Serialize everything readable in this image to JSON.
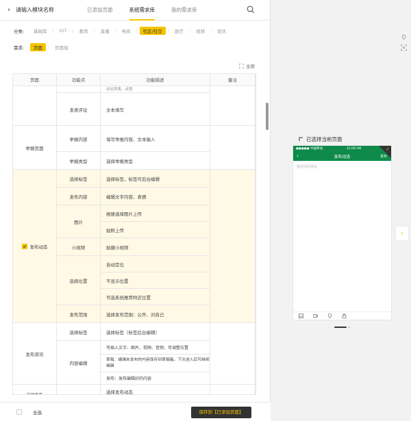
{
  "header": {
    "back": "‹",
    "module_name": "请输入模块名称",
    "tabs": [
      {
        "label": "已添加页面"
      },
      {
        "label": "系统需求库"
      },
      {
        "label": "我的需求库"
      }
    ]
  },
  "category": {
    "label": "分类:",
    "items": [
      "基础库",
      "IOT",
      "教育",
      "直播",
      "电商",
      "社区/社交",
      "医疗",
      "视频",
      "资讯"
    ],
    "selected": "社区/社交"
  },
  "demand": {
    "label": "需求:",
    "items": [
      "页面",
      "页面组"
    ],
    "selected": "页面"
  },
  "fullscreen_label": "全屏",
  "table": {
    "headers": [
      "页面",
      "功能点",
      "功能描述",
      "备注"
    ],
    "partial_top": "评论列表、点赞",
    "rows": {
      "comment_fn": "发表评论",
      "comment_desc": "文本填写",
      "report_page": "举报页面",
      "report_content_fn": "举报内容",
      "report_content_desc": "填写举报内容、文本输入",
      "report_type_fn": "举报类型",
      "report_type_desc": "选择举报类型",
      "post_page": "发布动态",
      "tag_fn": "选择标签",
      "tag_desc": "选择标签，标签可后台编辑",
      "content_fn": "发布内容",
      "content_desc": "编辑文字内容、表情",
      "image_fn": "图片",
      "image_desc1": "相册选择图片上传",
      "image_desc2": "拍照上传",
      "video_fn": "小视频",
      "video_desc": "拍摄小视频",
      "location_fn": "选择位置",
      "location_desc1": "自动定位",
      "location_desc2": "不显示位置",
      "location_desc3": "可选系统推荐附近位置",
      "scope_fn": "发布范围",
      "scope_desc": "选择发布范围：公开、对自己",
      "news_page": "发布资讯",
      "news_tag_fn": "选择标签",
      "news_tag_desc": "选择标签（标签后台编辑）",
      "edit_fn": "内容编辑",
      "edit_desc1": "可插入文字、图片、视频、音频，可调整位置",
      "edit_desc2": "草稿：编辑未发布的内容保存到草稿箱，下次进入后可继续编辑",
      "edit_desc3": "发布：发布编辑好的内容",
      "next_page": "选择发布",
      "next_desc": "选择发布动态"
    }
  },
  "footer": {
    "select_all": "全选",
    "save_button": "保存到【已添加页面】"
  },
  "preview": {
    "title": "已选择当前页面",
    "status_left": "●●●●● 中国移动",
    "status_time": "12:08 AM",
    "status_right": "▮▮",
    "nav_title": "发布动态",
    "nav_back": "‹",
    "nav_send": "发布",
    "placeholder": "描述你的建议",
    "next": "›"
  },
  "colors": {
    "accent": "#f5c400",
    "phone_green": "#0e8a4a",
    "highlight_row": "#fff9e6"
  }
}
